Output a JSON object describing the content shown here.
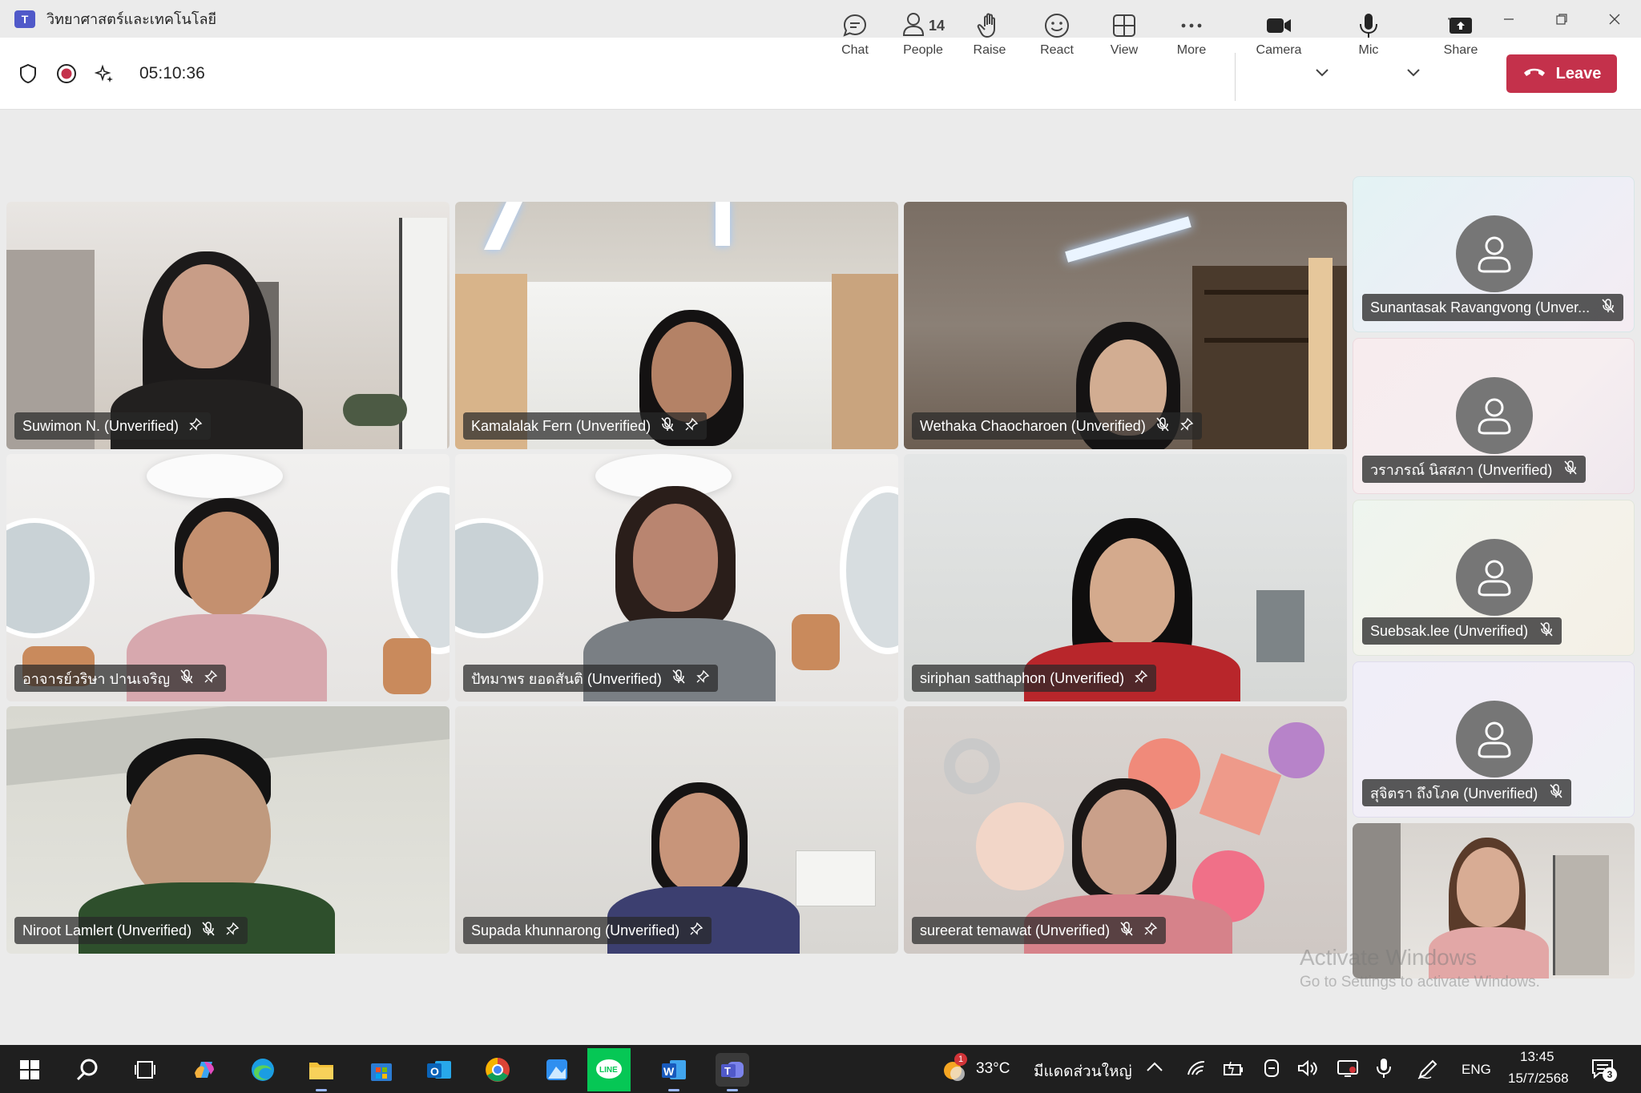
{
  "titlebar": {
    "app_icon": "teams-icon",
    "title": "วิทยาศาสตร์และเทคโนโลยี"
  },
  "toolbar": {
    "timer": "05:10:36",
    "people_count": "14",
    "buttons": {
      "chat": "Chat",
      "people": "People",
      "raise": "Raise",
      "react": "React",
      "view": "View",
      "more": "More",
      "camera": "Camera",
      "mic": "Mic",
      "share": "Share"
    },
    "leave": "Leave"
  },
  "tiles": [
    {
      "name": "Suwimon N. (Unverified)"
    },
    {
      "name": "Kamalalak Fern (Unverified)"
    },
    {
      "name": "Wethaka Chaocharoen (Unverified)"
    },
    {
      "name": "อาจารย์วริษา ปานเจริญ"
    },
    {
      "name": "ปัทมาพร ยอดสันติ (Unverified)"
    },
    {
      "name": "siriphan satthaphon (Unverified)"
    },
    {
      "name": "Niroot Lamlert (Unverified)"
    },
    {
      "name": "Supada khunnarong (Unverified)"
    },
    {
      "name": "sureerat temawat (Unverified)"
    }
  ],
  "side_tiles": [
    {
      "name": "Sunantasak Ravangvong (Unver..."
    },
    {
      "name": "วราภรณ์ นิสสภา (Unverified)"
    },
    {
      "name": "Suebsak.lee (Unverified)"
    },
    {
      "name": "สุจิตรา ถึงโภค (Unverified)"
    }
  ],
  "watermark": {
    "line1": "Activate Windows",
    "line2": "Go to Settings to activate Windows."
  },
  "taskbar": {
    "weather": "33°C",
    "weather_desc": "มีแดดส่วนใหญ่",
    "weather_badge": "1",
    "lang": "ENG",
    "time": "13:45",
    "date": "15/7/2568",
    "notif_count": "3"
  }
}
